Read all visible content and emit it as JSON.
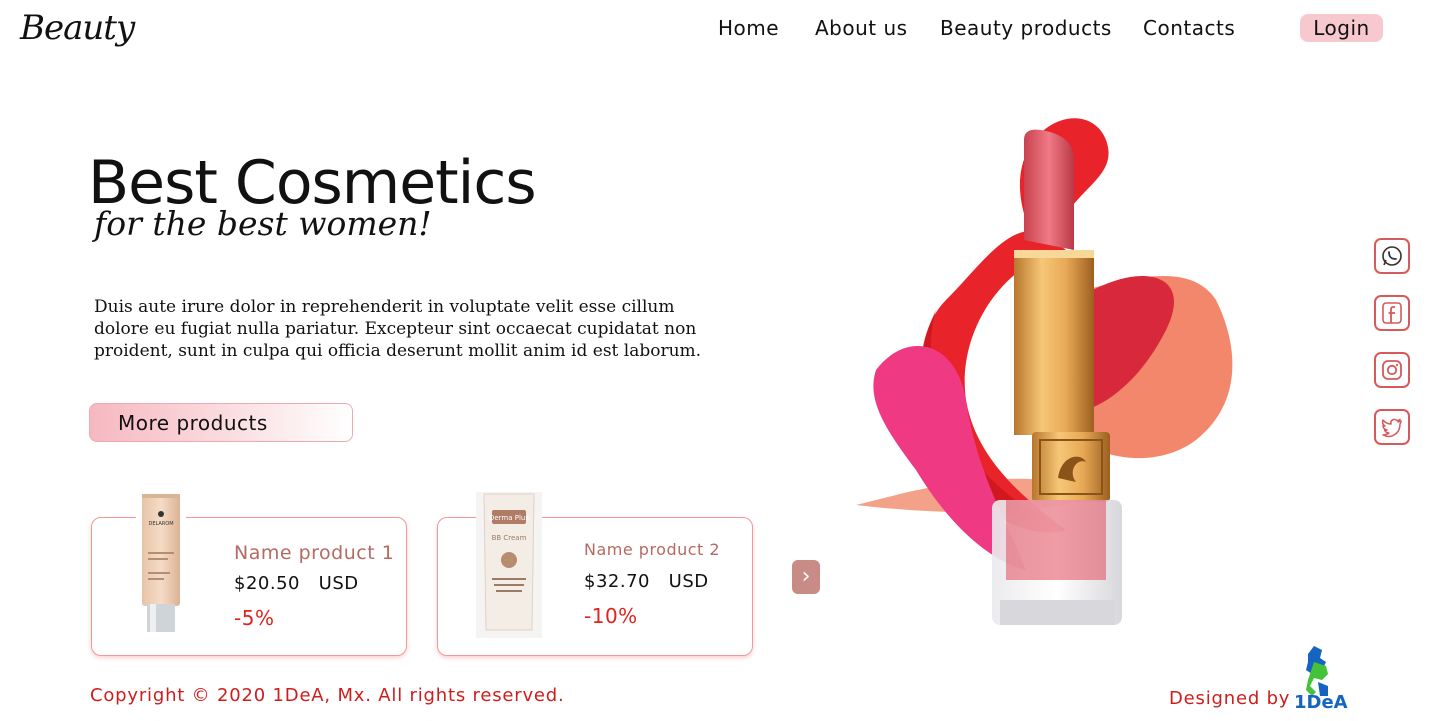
{
  "header": {
    "logo": "Beauty",
    "nav": [
      "Home",
      "About us",
      "Beauty products",
      "Contacts"
    ],
    "login_label": "Login"
  },
  "hero": {
    "title": "Best Cosmetics",
    "subtitle": "for the best women!",
    "description": "Duis aute irure dolor in reprehenderit in voluptate velit esse cillum dolore eu fugiat nulla pariatur. Excepteur sint occaecat cupidatat non proident, sunt in culpa qui officia deserunt mollit anim id est laborum.",
    "cta_label": "More products"
  },
  "products": [
    {
      "name": "Name product 1",
      "price": "$20.50",
      "currency": "USD",
      "discount": "-5%",
      "brand": "DELAROM"
    },
    {
      "name": "Name product 2",
      "price": "$32.70",
      "currency": "USD",
      "discount": "-10%",
      "brand": "Derma Plus",
      "label": "BB Cream"
    }
  ],
  "social": [
    "whatsapp-icon",
    "facebook-icon",
    "instagram-icon",
    "twitter-icon"
  ],
  "footer": {
    "copyright": "Copyright © 2020 1DeA, Mx. All rights reserved.",
    "designed_by": "Designed by",
    "designer_logo": "1DeA"
  },
  "colors": {
    "accent_pink": "#f7c9cf",
    "text_red": "#cf1d1d",
    "product_name": "#b56a62",
    "discount_red": "#e1231e",
    "card_border": "#f09a9a"
  }
}
